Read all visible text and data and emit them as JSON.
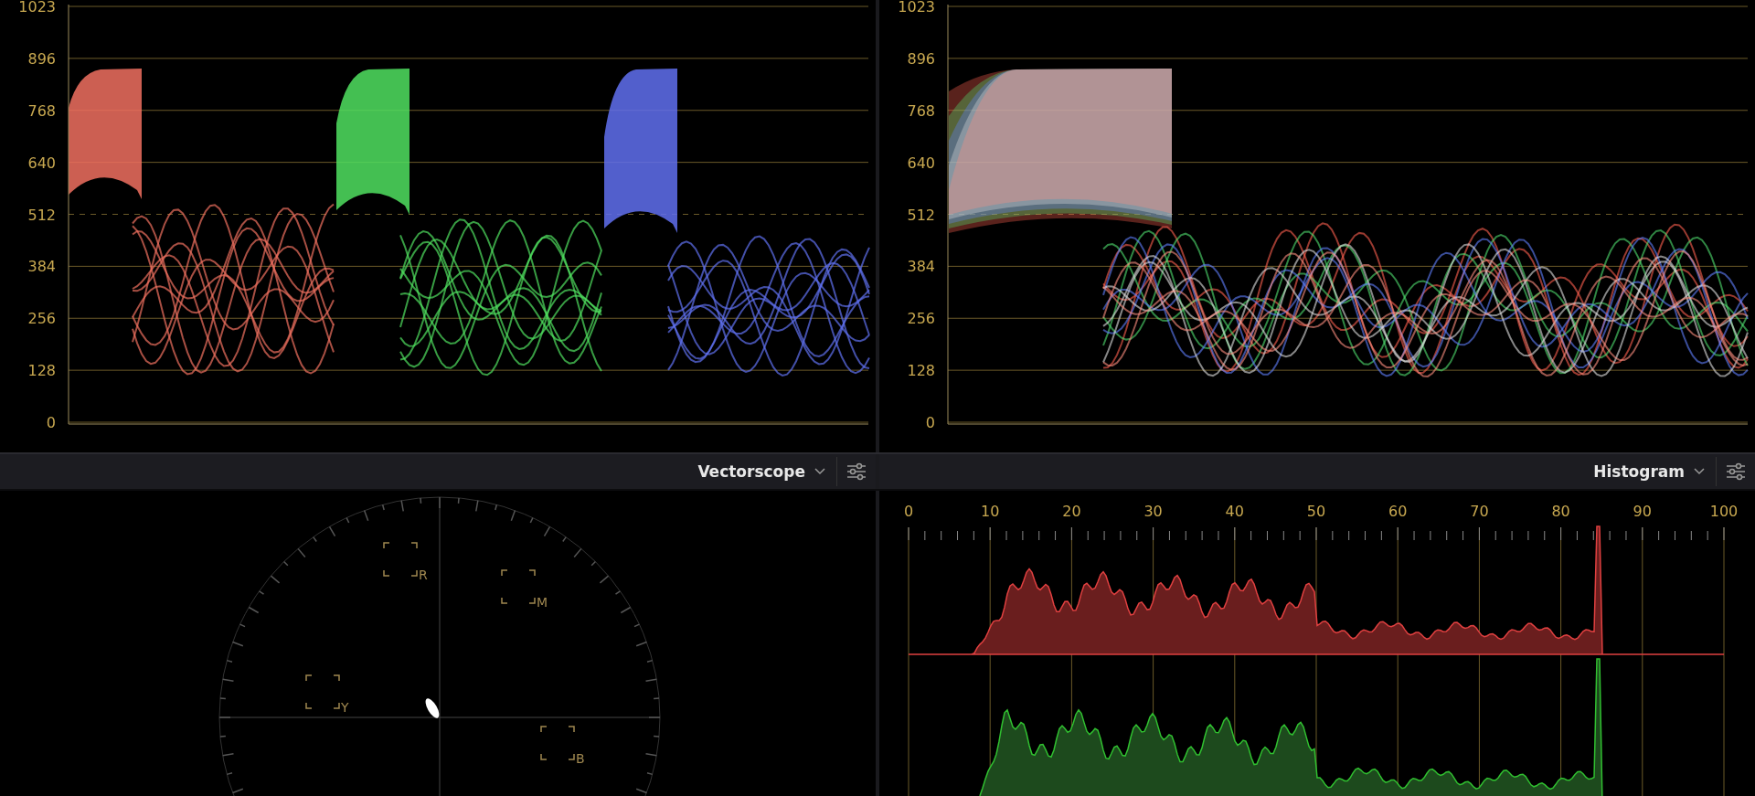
{
  "parade": {
    "y_ticks": [
      "1023",
      "896",
      "768",
      "640",
      "512",
      "384",
      "256",
      "128",
      "0"
    ]
  },
  "overlay": {
    "y_ticks": [
      "1023",
      "896",
      "768",
      "640",
      "512",
      "384",
      "256",
      "128",
      "0"
    ]
  },
  "vectorscope": {
    "title": "Vectorscope",
    "targets": [
      "R",
      "M",
      "Y",
      "B"
    ]
  },
  "histogram": {
    "title": "Histogram",
    "x_ticks": [
      "0",
      "10",
      "20",
      "30",
      "40",
      "50",
      "60",
      "70",
      "80",
      "90",
      "100"
    ]
  }
}
